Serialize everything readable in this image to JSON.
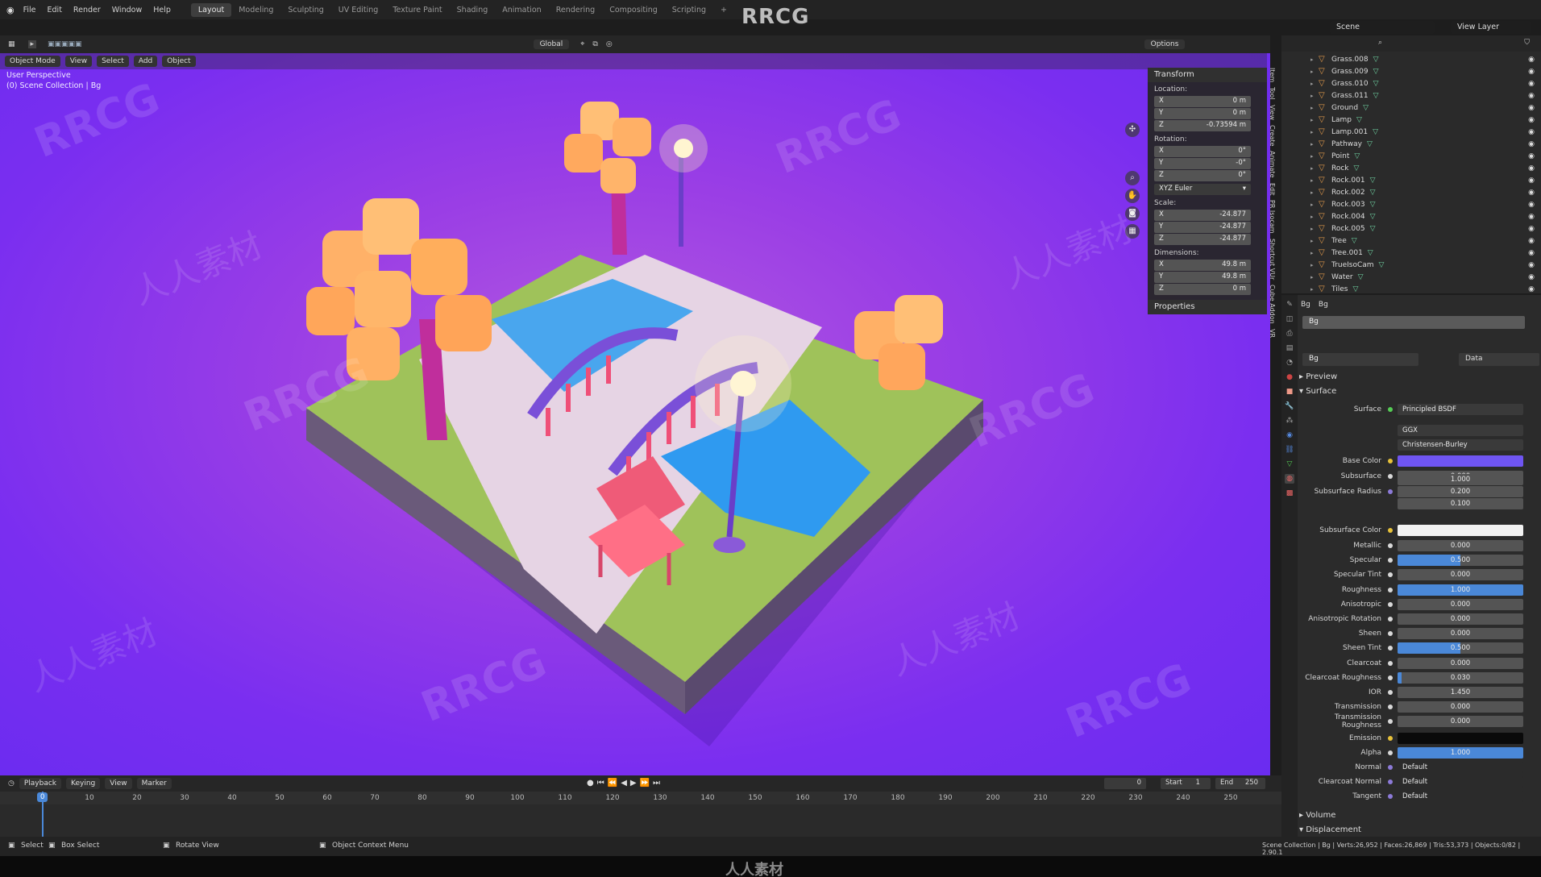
{
  "app": {
    "watermark_title": "RRCG",
    "brand_footer": "人人素材"
  },
  "menu": [
    "File",
    "Edit",
    "Render",
    "Window",
    "Help"
  ],
  "workspaces": [
    "Layout",
    "Modeling",
    "Sculpting",
    "UV Editing",
    "Texture Paint",
    "Shading",
    "Animation",
    "Rendering",
    "Compositing",
    "Scripting"
  ],
  "workspace_add": "+",
  "scene_name": "Scene",
  "view_layer": "View Layer",
  "viewport_header": {
    "mode": "Object Mode",
    "menus": [
      "View",
      "Select",
      "Add",
      "Object"
    ],
    "transform_orientation": "Global",
    "options": "Options"
  },
  "viewport_info": {
    "line1": "User Perspective",
    "line2": "(0) Scene Collection | Bg"
  },
  "n_panel": {
    "title": "Transform",
    "location_label": "Location:",
    "location": [
      {
        "axis": "X",
        "value": "0 m"
      },
      {
        "axis": "Y",
        "value": "0 m"
      },
      {
        "axis": "Z",
        "value": "-0.73594 m"
      }
    ],
    "rotation_label": "Rotation:",
    "rotation": [
      {
        "axis": "X",
        "value": "0°"
      },
      {
        "axis": "Y",
        "value": "-0°"
      },
      {
        "axis": "Z",
        "value": "0°"
      }
    ],
    "rotation_mode": "XYZ Euler",
    "scale_label": "Scale:",
    "scale": [
      {
        "axis": "X",
        "value": "-24.877"
      },
      {
        "axis": "Y",
        "value": "-24.877"
      },
      {
        "axis": "Z",
        "value": "-24.877"
      }
    ],
    "dimensions_label": "Dimensions:",
    "dimensions": [
      {
        "axis": "X",
        "value": "49.8 m"
      },
      {
        "axis": "Y",
        "value": "49.8 m"
      },
      {
        "axis": "Z",
        "value": "0 m"
      }
    ],
    "properties": "Properties",
    "side_tabs": [
      "Item",
      "Tool",
      "View",
      "Create",
      "Animate",
      "Edit",
      "PR Isocam",
      "Shortcut VUr",
      "Cube Addon",
      "VR"
    ]
  },
  "outliner": {
    "items": [
      "Grass.008",
      "Grass.009",
      "Grass.010",
      "Grass.011",
      "Ground",
      "Lamp",
      "Lamp.001",
      "Pathway",
      "Point",
      "Rock",
      "Rock.001",
      "Rock.002",
      "Rock.003",
      "Rock.004",
      "Rock.005",
      "Tree",
      "Tree.001",
      "TrueIsoCam",
      "Water",
      "Tiles"
    ]
  },
  "properties_header": {
    "object": "Bg",
    "material": "Bg",
    "slot": "Bg",
    "material_name": "Bg",
    "data_label": "Data"
  },
  "material": {
    "preview": "Preview",
    "surface_section": "Surface",
    "surface_label": "Surface",
    "surface_value": "Principled BSDF",
    "distribution": "GGX",
    "subsurface_method": "Christensen-Burley",
    "base_color_label": "Base Color",
    "base_color": "#6f55f2",
    "subsurface_color_label": "Subsurface Color",
    "subsurface_color": "#f2f2f2",
    "emission_label": "Emission",
    "emission_color": "#0a0a0a",
    "subsurface_radius_label": "Subsurface Radius",
    "subsurface_radius": [
      "1.000",
      "0.200",
      "0.100"
    ],
    "inputs": [
      {
        "label": "Subsurface",
        "value": "0.000",
        "fill": 0
      },
      {
        "label": "Metallic",
        "value": "0.000",
        "fill": 0
      },
      {
        "label": "Specular",
        "value": "0.500",
        "fill": 0.5
      },
      {
        "label": "Specular Tint",
        "value": "0.000",
        "fill": 0
      },
      {
        "label": "Roughness",
        "value": "1.000",
        "fill": 1
      },
      {
        "label": "Anisotropic",
        "value": "0.000",
        "fill": 0
      },
      {
        "label": "Anisotropic Rotation",
        "value": "0.000",
        "fill": 0
      },
      {
        "label": "Sheen",
        "value": "0.000",
        "fill": 0
      },
      {
        "label": "Sheen Tint",
        "value": "0.500",
        "fill": 0.5
      },
      {
        "label": "Clearcoat",
        "value": "0.000",
        "fill": 0
      },
      {
        "label": "Clearcoat Roughness",
        "value": "0.030",
        "fill": 0.03
      },
      {
        "label": "IOR",
        "value": "1.450",
        "fill": 0
      },
      {
        "label": "Transmission",
        "value": "0.000",
        "fill": 0
      },
      {
        "label": "Transmission Roughness",
        "value": "0.000",
        "fill": 0
      }
    ],
    "alpha_label": "Alpha",
    "alpha_value": "1.000",
    "normal_label": "Normal",
    "normal_value": "Default",
    "clearcoat_normal_label": "Clearcoat Normal",
    "clearcoat_normal_value": "Default",
    "tangent_label": "Tangent",
    "tangent_value": "Default",
    "volume": "Volume",
    "displacement": "Displacement"
  },
  "timeline": {
    "menus": [
      "Playback",
      "Keying",
      "View",
      "Marker"
    ],
    "current_frame": "0",
    "start_label": "Start",
    "start": "1",
    "end_label": "End",
    "end": "250",
    "ticks": [
      "0",
      "10",
      "20",
      "30",
      "40",
      "50",
      "60",
      "70",
      "80",
      "90",
      "100",
      "110",
      "120",
      "130",
      "140",
      "150",
      "160",
      "170",
      "180",
      "190",
      "200",
      "210",
      "220",
      "230",
      "240",
      "250"
    ]
  },
  "status": {
    "select": "Select",
    "box_select": "Box Select",
    "rotate_view": "Rotate View",
    "context_menu": "Object Context Menu",
    "stats": "Scene Collection | Bg | Verts:26,952 | Faces:26,869 | Tris:53,373 | Objects:0/82 | 2.90.1"
  }
}
